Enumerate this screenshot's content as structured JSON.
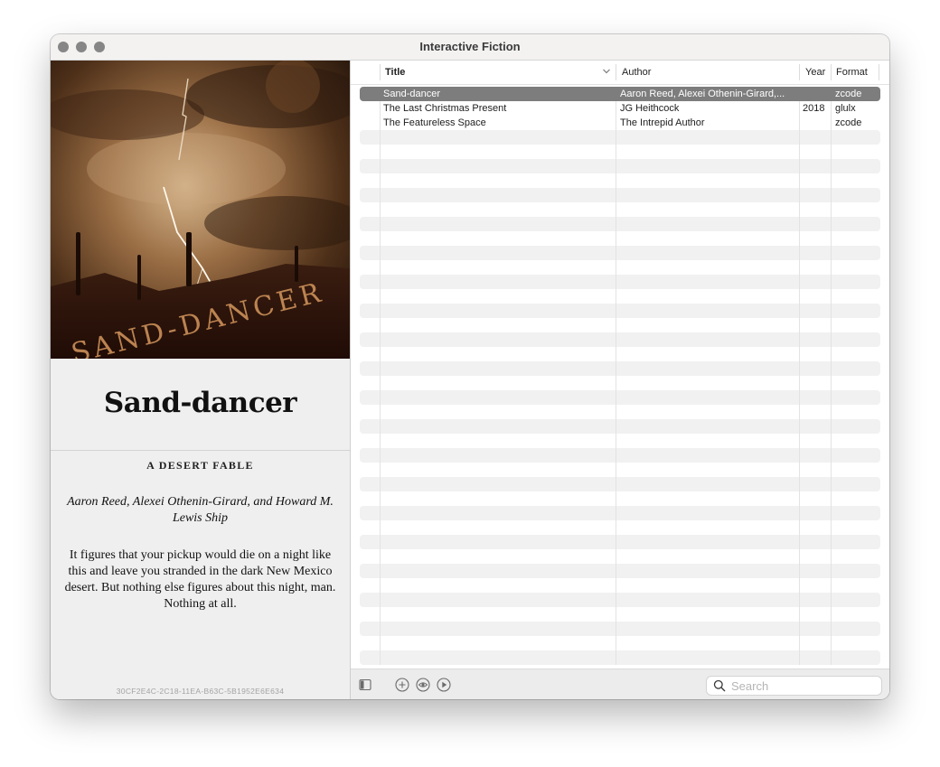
{
  "window": {
    "title": "Interactive Fiction"
  },
  "detail": {
    "title": "Sand-dancer",
    "headline": "A DESERT FABLE",
    "authors": "Aaron Reed, Alexei Othenin-Girard, and Howard M. Lewis Ship",
    "blurb": "It figures that your pickup would die on a night like this and leave you stranded in the dark New Mexico desert. But nothing else figures about this night, man. Nothing at all.",
    "ifid": "30CF2E4C-2C18-11EA-B63C-5B1952E6E634",
    "cover": {
      "text": "SAND-DANCER"
    }
  },
  "table": {
    "columns": [
      "Title",
      "Author",
      "Year",
      "Format"
    ],
    "sort_column": "Title",
    "rows": [
      {
        "title": "Sand-dancer",
        "author": "Aaron Reed, Alexei Othenin-Girard,...",
        "year": "",
        "format": "zcode",
        "selected": true
      },
      {
        "title": "The Last Christmas Present",
        "author": "JG Heithcock",
        "year": "2018",
        "format": "glulx",
        "selected": false
      },
      {
        "title": "The Featureless Space",
        "author": "The Intrepid Author",
        "year": "",
        "format": "zcode",
        "selected": false
      }
    ]
  },
  "toolbar": {
    "icons": [
      "sidebar-toggle-icon",
      "add-icon",
      "eye-icon",
      "play-icon"
    ],
    "search_placeholder": "Search"
  },
  "colors": {
    "selection": "#7d7d7d",
    "stripe": "#f1f1f1",
    "traffic_light": "#868686"
  }
}
